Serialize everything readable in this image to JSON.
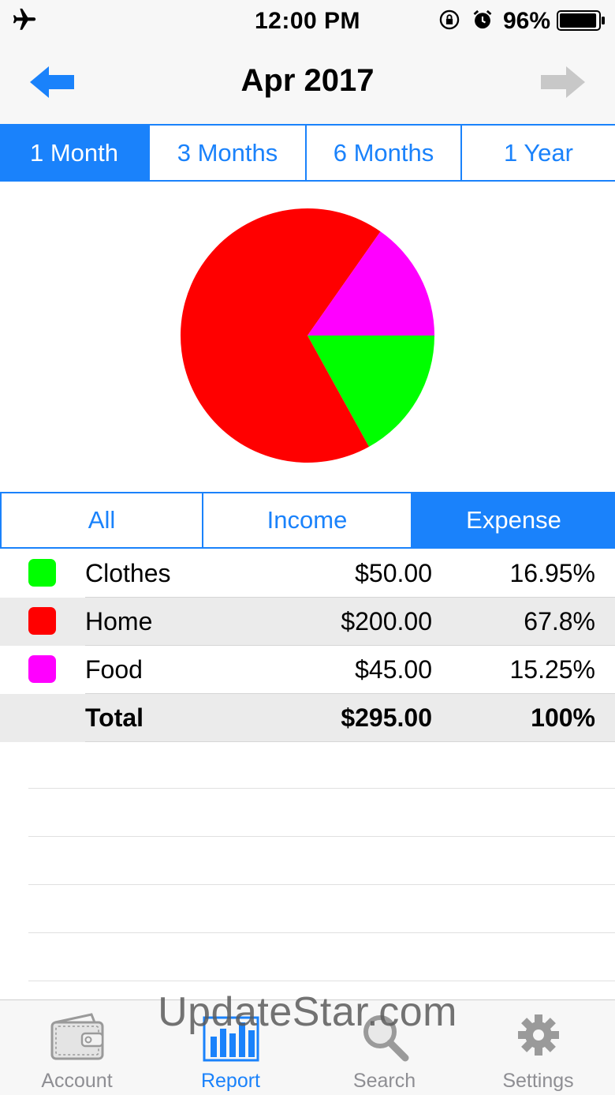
{
  "status_bar": {
    "time": "12:00 PM",
    "battery_percent": "96%",
    "battery_level": 0.96,
    "icons": [
      "airplane-icon",
      "rotation-lock-icon",
      "alarm-icon",
      "battery-icon"
    ]
  },
  "nav": {
    "title": "Apr 2017",
    "prev_icon": "arrow-left-icon",
    "next_icon": "arrow-right-icon"
  },
  "period_tabs": {
    "items": [
      "1 Month",
      "3 Months",
      "6 Months",
      "1 Year"
    ],
    "selected": "1 Month"
  },
  "type_tabs": {
    "items": [
      "All",
      "Income",
      "Expense"
    ],
    "selected": "Expense"
  },
  "chart_data": {
    "type": "pie",
    "slices": [
      {
        "label": "Clothes",
        "value": 50.0,
        "percent": 16.95,
        "color": "#00ff00"
      },
      {
        "label": "Home",
        "value": 200.0,
        "percent": 67.8,
        "color": "#ff0000"
      },
      {
        "label": "Food",
        "value": 45.0,
        "percent": 15.25,
        "color": "#ff00ff"
      }
    ]
  },
  "table": {
    "rows": [
      {
        "name": "Clothes",
        "amount": "$50.00",
        "percent": "16.95%",
        "color": "#00ff00"
      },
      {
        "name": "Home",
        "amount": "$200.00",
        "percent": "67.8%",
        "color": "#ff0000"
      },
      {
        "name": "Food",
        "amount": "$45.00",
        "percent": "15.25%",
        "color": "#ff00ff"
      }
    ],
    "total": {
      "name": "Total",
      "amount": "$295.00",
      "percent": "100%"
    }
  },
  "tab_bar": {
    "items": [
      {
        "label": "Account",
        "icon": "wallet-icon"
      },
      {
        "label": "Report",
        "icon": "bar-chart-icon"
      },
      {
        "label": "Search",
        "icon": "magnifier-icon"
      },
      {
        "label": "Settings",
        "icon": "gear-icon"
      }
    ],
    "selected": "Report"
  },
  "watermark": "UpdateStar.com",
  "colors": {
    "accent": "#1a82fb",
    "inactive": "#8e8e93"
  }
}
